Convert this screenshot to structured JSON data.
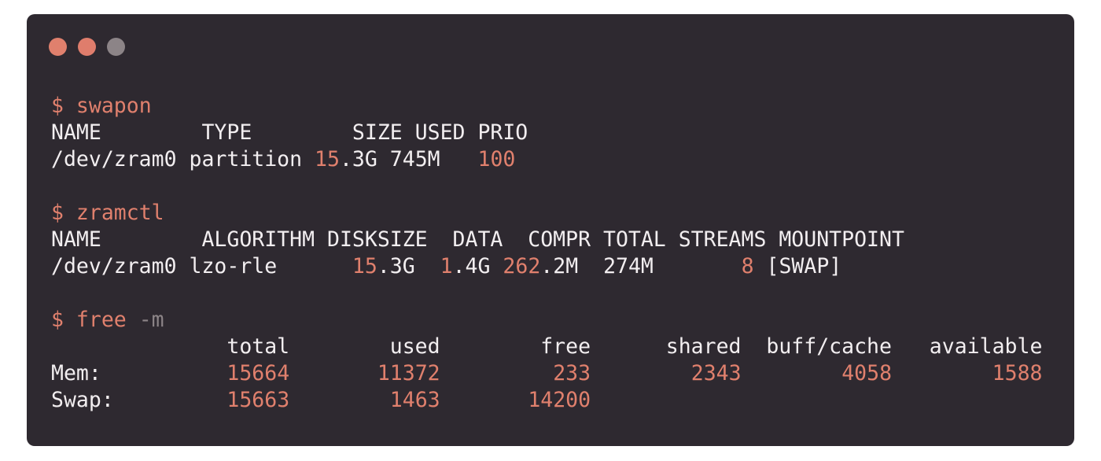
{
  "window": {
    "controls": [
      "close",
      "minimize",
      "maximize"
    ]
  },
  "colors": {
    "background": "#2e2930",
    "text": "#f2eef0",
    "accent": "#e0806d",
    "muted": "#8c8487"
  },
  "swapon": {
    "prompt": "$ ",
    "command": "swapon",
    "header": "NAME        TYPE        SIZE USED PRIO",
    "row": {
      "name": "/dev/zram0 ",
      "type": "partition ",
      "size_num": "15",
      "size_rest": ".3G",
      "used": " 745M  ",
      "prio": " 100"
    }
  },
  "zramctl": {
    "prompt": "$ ",
    "command": "zramctl",
    "header": "NAME        ALGORITHM DISKSIZE  DATA  COMPR TOTAL STREAMS MOUNTPOINT",
    "row": {
      "name": "/dev/zram0 ",
      "algorithm": "lzo-rle      ",
      "disksize_num": "15",
      "disksize_rest": ".3G  ",
      "data_num": "1",
      "data_rest": ".4G ",
      "compr_num": "262",
      "compr_rest": ".2M  274M       ",
      "streams": "8",
      "mountpoint": " [SWAP]"
    }
  },
  "free": {
    "prompt": "$ ",
    "command": "free",
    "flag": " -m",
    "header": "              total        used        free      shared  buff/cache   available",
    "mem_label": "Mem:",
    "mem_pad": "          ",
    "mem_total": "15664",
    "mem_used": "11372",
    "mem_free": "233",
    "mem_shared": "2343",
    "mem_buff": "4058",
    "mem_available": "1588",
    "swap_label": "Swap:",
    "swap_pad": "         ",
    "swap_total": "15663",
    "swap_used": "1463",
    "swap_free": "14200"
  }
}
